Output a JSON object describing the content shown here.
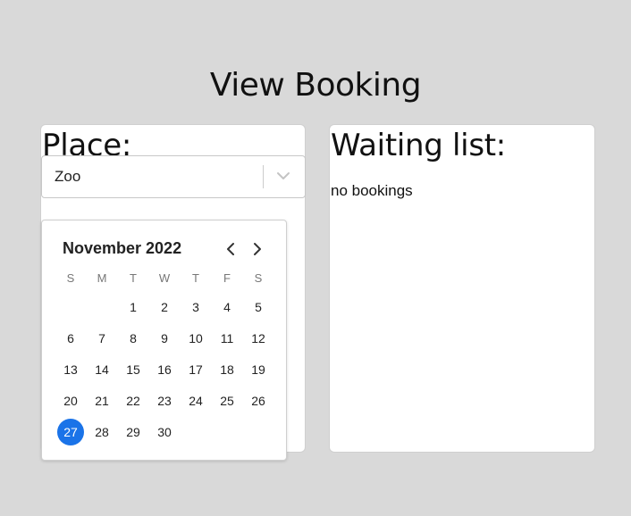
{
  "page": {
    "title": "View Booking"
  },
  "place": {
    "heading": "Place:",
    "selected": "Zoo"
  },
  "calendar": {
    "month_label": "November 2022",
    "weekdays": [
      "S",
      "M",
      "T",
      "W",
      "T",
      "F",
      "S"
    ],
    "weeks": [
      [
        "",
        "",
        "1",
        "2",
        "3",
        "4",
        "5"
      ],
      [
        "6",
        "7",
        "8",
        "9",
        "10",
        "11",
        "12"
      ],
      [
        "13",
        "14",
        "15",
        "16",
        "17",
        "18",
        "19"
      ],
      [
        "20",
        "21",
        "22",
        "23",
        "24",
        "25",
        "26"
      ],
      [
        "27",
        "28",
        "29",
        "30",
        "",
        "",
        ""
      ]
    ],
    "selected_day": "27",
    "selected_color": "#1a73e8"
  },
  "waiting_list": {
    "heading": "Waiting list:",
    "empty_text": "no bookings"
  }
}
